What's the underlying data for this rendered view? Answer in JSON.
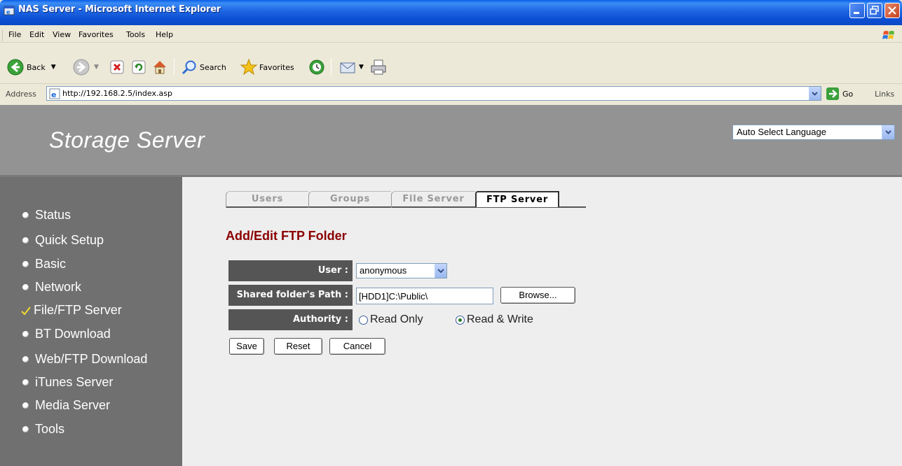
{
  "window": {
    "title": "NAS Server - Microsoft Internet Explorer"
  },
  "menu": [
    "File",
    "Edit",
    "View",
    "Favorites",
    "Tools",
    "Help"
  ],
  "toolbar": {
    "back_label": "Back",
    "search_label": "Search",
    "favorites_label": "Favorites"
  },
  "address": {
    "label": "Address",
    "url": "http://192.168.2.5/index.asp",
    "go_label": "Go",
    "links_label": "Links"
  },
  "header": {
    "brand": "Storage Server",
    "language": "Auto Select Language"
  },
  "sidebar": {
    "items": [
      {
        "label": "Status"
      },
      {
        "label": "Quick Setup"
      },
      {
        "label": "Basic"
      },
      {
        "label": "Network"
      },
      {
        "label": "File/FTP Server"
      },
      {
        "label": "BT Download"
      },
      {
        "label": "Web/FTP Download"
      },
      {
        "label": "iTunes Server"
      },
      {
        "label": "Media Server"
      },
      {
        "label": "Tools"
      }
    ]
  },
  "tabs": [
    {
      "label": "Users"
    },
    {
      "label": "Groups"
    },
    {
      "label": "File Server"
    },
    {
      "label": "FTP Server"
    }
  ],
  "page": {
    "title": "Add/Edit FTP Folder"
  },
  "form": {
    "user_label": "User :",
    "user_value": "anonymous",
    "path_label": "Shared folder's Path :",
    "path_value": "[HDD1]C:\\Public\\",
    "browse_label": "Browse...",
    "authority_label": "Authority :",
    "read_only_label": "Read Only",
    "read_write_label": "Read & Write",
    "authority_selected": "Read & Write"
  },
  "actions": {
    "save_label": "Save",
    "reset_label": "Reset",
    "cancel_label": "Cancel"
  },
  "colors": {
    "title_red": "#8b0000",
    "label_bg": "#555555",
    "sidebar_bg": "#707070",
    "header_bg": "#939393"
  }
}
